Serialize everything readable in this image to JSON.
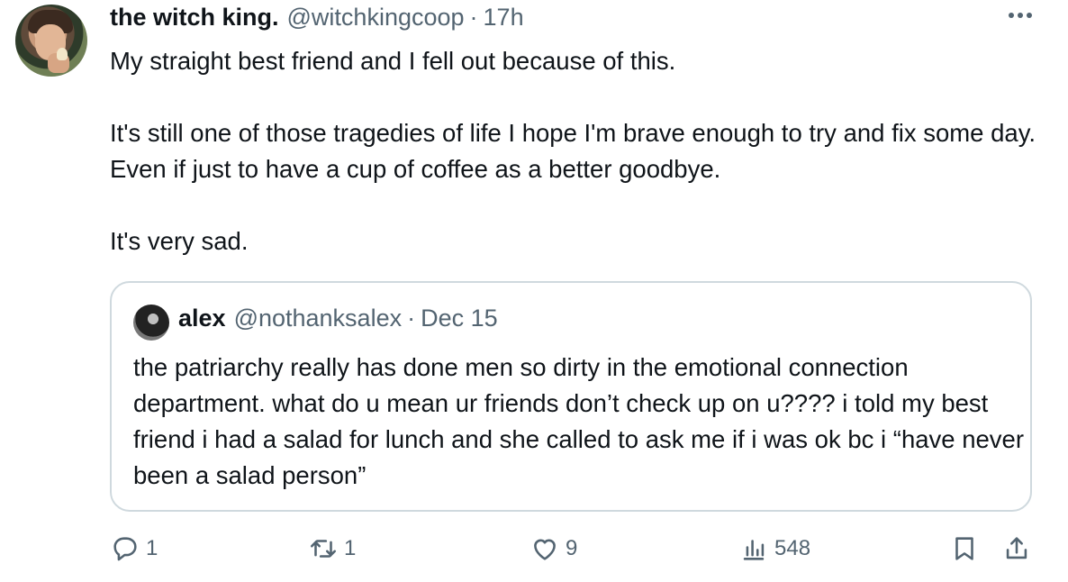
{
  "tweet": {
    "name": "the witch king.",
    "handle": "@witchkingcoop",
    "separator": "·",
    "time": "17h",
    "text": "My straight best friend and I fell out because of this.\n\nIt's still one of those tragedies of life I hope I'm brave enough to try and fix some day. Even if just to have a cup of coffee as a better goodbye.\n\nIt's very sad."
  },
  "quote": {
    "name": "alex",
    "handle": "@nothanksalex",
    "separator": "·",
    "time": "Dec 15",
    "text": "the patriarchy really has done men so dirty in the emotional connection department. what do u mean ur friends don’t check up on u???? i told my best friend i had a salad for lunch and she called to ask me if i was ok bc i “have never been a salad person”"
  },
  "actions": {
    "replies": "1",
    "reposts": "1",
    "likes": "9",
    "views": "548"
  },
  "icons": {
    "more": "more-horizontal-icon",
    "reply": "reply-bubble-icon",
    "repost": "repost-icon",
    "like": "heart-icon",
    "views": "bar-chart-icon",
    "bookmark": "bookmark-icon",
    "share": "share-upload-icon"
  },
  "colors": {
    "text": "#0f1419",
    "secondary": "#536471",
    "border": "#cfd9de"
  }
}
